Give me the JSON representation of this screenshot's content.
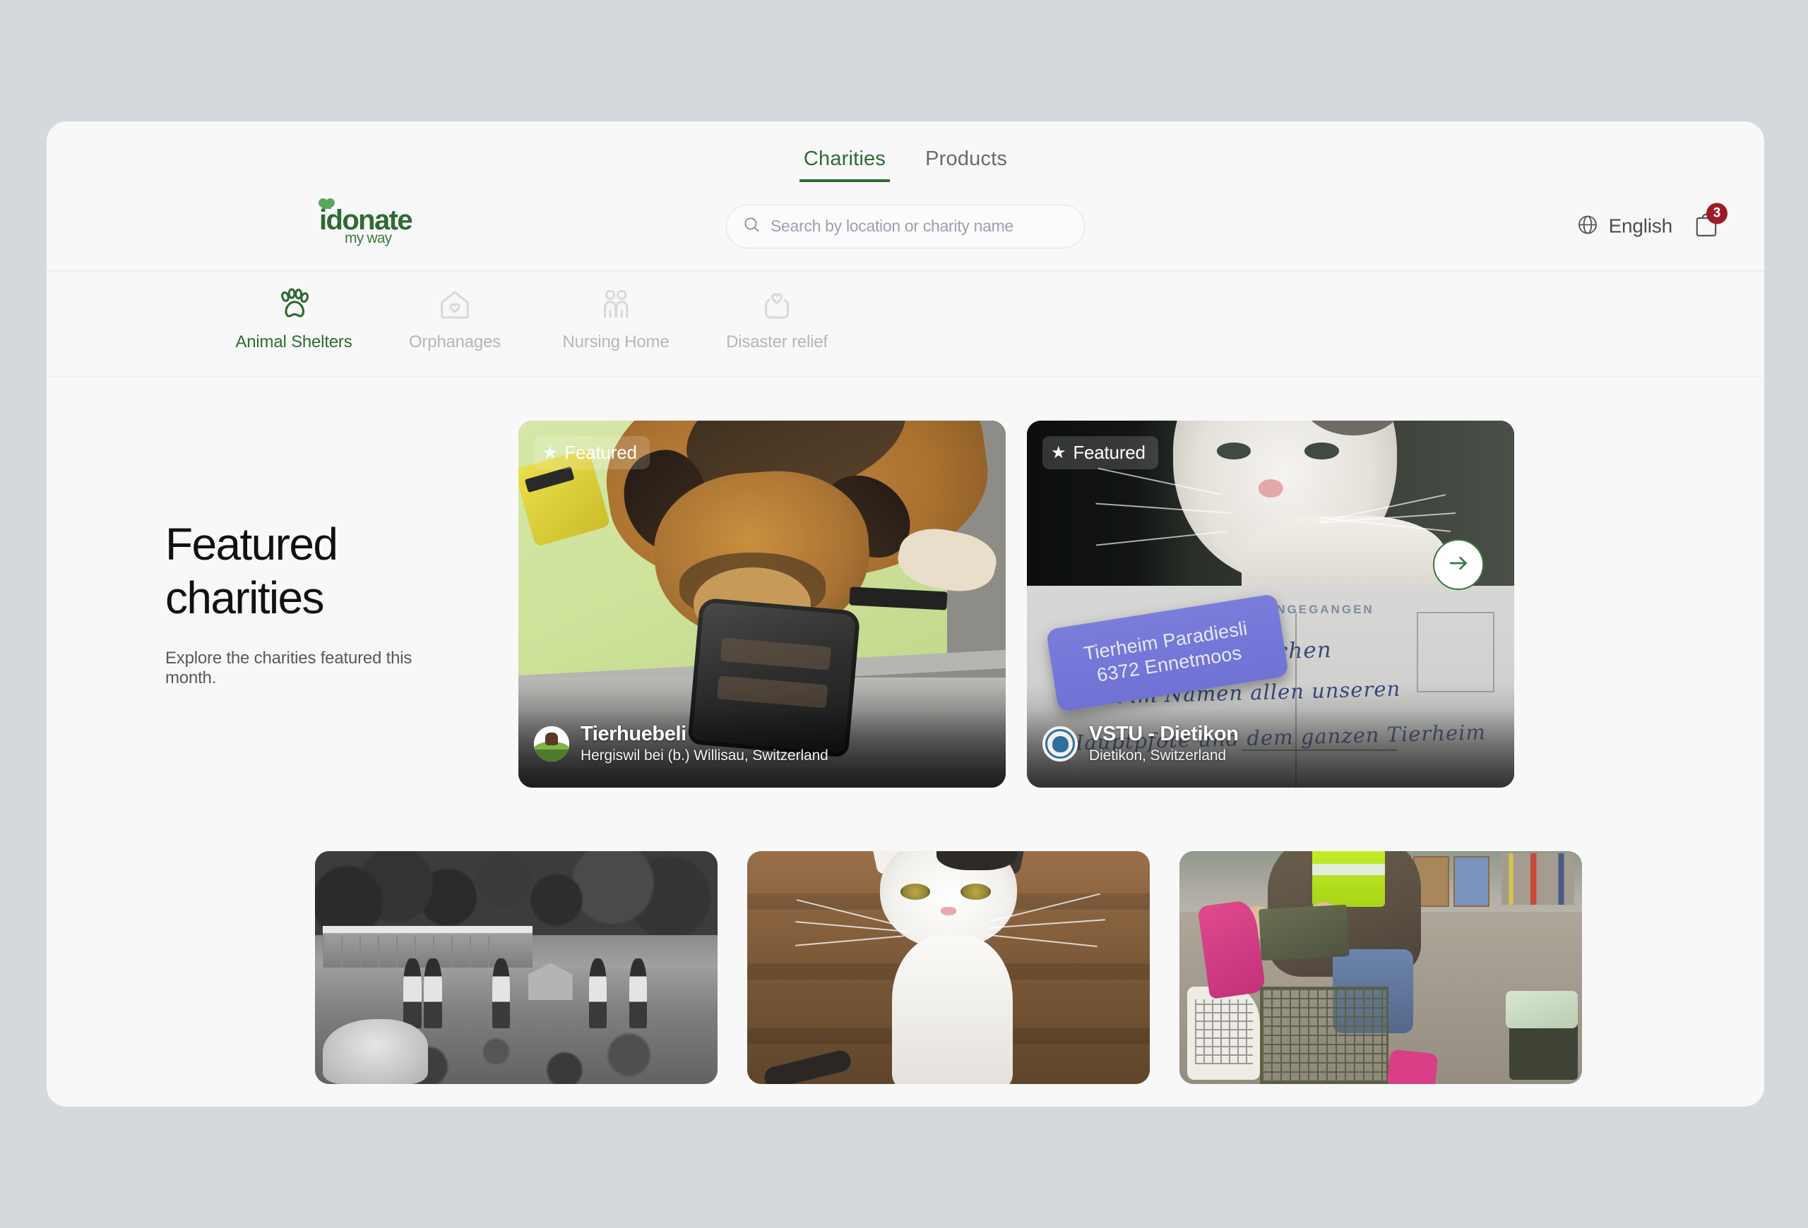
{
  "top_tabs": [
    {
      "label": "Charities",
      "active": true
    },
    {
      "label": "Products",
      "active": false
    }
  ],
  "brand": {
    "name": "idonate",
    "tagline": "my way",
    "color": "#2f6b34"
  },
  "search": {
    "placeholder": "Search by location or charity name",
    "value": "",
    "icon": "search-icon"
  },
  "header_right": {
    "language_label": "English",
    "language_icon": "globe-icon",
    "cart_icon": "shopping-bag-icon",
    "cart_badge": "3",
    "badge_color": "#9e1b26"
  },
  "categories": [
    {
      "label": "Animal Shelters",
      "icon": "paw-icon",
      "active": true
    },
    {
      "label": "Orphanages",
      "icon": "house-heart-icon",
      "active": false
    },
    {
      "label": "Nursing Home",
      "icon": "two-people-icon",
      "active": false
    },
    {
      "label": "Disaster relief",
      "icon": "hands-heart-icon",
      "active": false
    }
  ],
  "featured": {
    "title_line1": "Featured",
    "title_line2": "charities",
    "subtitle": "Explore the charities featured this month.",
    "next_icon": "arrow-right-icon",
    "cards": [
      {
        "badge": "Featured",
        "badge_icon": "star-icon",
        "name": "Tierhuebeli",
        "location": "Hergiswil bei (b.) Willisau, Switzerland",
        "avatar": "tierhuebeli-logo",
        "photo_alt": "german-shepherd-with-muzzle-on-vet-table"
      },
      {
        "badge": "Featured",
        "badge_icon": "star-icon",
        "name": "VSTU - Dietikon",
        "location": "Dietikon, Switzerland",
        "avatar": "vstu-dietikon-logo",
        "photo_alt": "cat-and-handwritten-thank-you-postcard",
        "photo_label_line1": "Tierheim Paradiesli",
        "photo_label_line2": "6372 Ennetmoos",
        "photo_stamp": "EINGEGANGEN",
        "photo_handwriting_line1": "Ganz, ganz Herzlichen",
        "photo_handwriting_line2": "Dank im Namen allen unseren",
        "photo_handwriting_line3": "Hauptpfote und dem ganzen Tierheim"
      }
    ]
  },
  "bottom_cards": [
    {
      "photo_alt": "black-and-white-historic-shelter-with-dogs-and-people"
    },
    {
      "photo_alt": "white-cat-looking-up-on-wooden-background"
    },
    {
      "photo_alt": "volunteer-in-hi-vis-vest-with-animal-trap-cage"
    }
  ]
}
